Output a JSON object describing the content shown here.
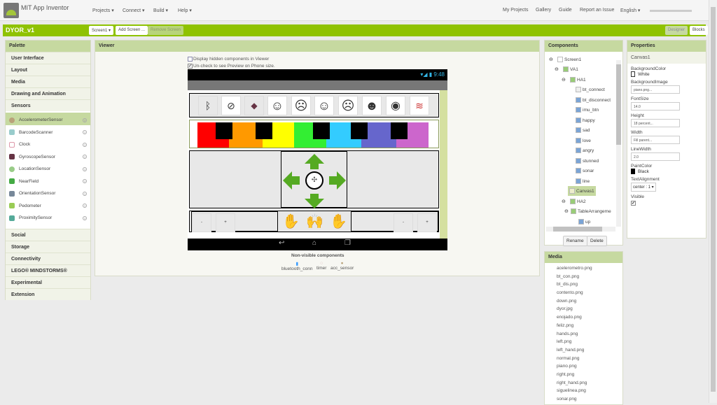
{
  "header": {
    "app_title": "MIT App Inventor",
    "menus": [
      "Projects ▾",
      "Connect ▾",
      "Build ▾",
      "Help ▾"
    ],
    "right_links": [
      "My Projects",
      "Gallery",
      "Guide",
      "Report an Issue",
      "English ▾"
    ]
  },
  "toolbar": {
    "project_name": "DYOR_v1",
    "screen_select": "Screen1 ▾",
    "add_screen": "Add Screen ...",
    "remove_screen": "Remove Screen",
    "designer": "Designer",
    "blocks": "Blocks"
  },
  "palette": {
    "title": "Palette",
    "categories_top": [
      "User Interface",
      "Layout",
      "Media",
      "Drawing and Animation",
      "Sensors"
    ],
    "sensors": [
      "AccelerometerSensor",
      "BarcodeScanner",
      "Clock",
      "GyroscopeSensor",
      "LocationSensor",
      "NearField",
      "OrientationSensor",
      "Pedometer",
      "ProximitySensor"
    ],
    "categories_bottom": [
      "Social",
      "Storage",
      "Connectivity",
      "LEGO® MINDSTORMS®",
      "Experimental",
      "Extension"
    ]
  },
  "viewer": {
    "title": "Viewer",
    "display_hidden": "Display hidden components in Viewer",
    "uncheck_preview": "Un-check to see Preview on Phone size.",
    "clock": "9:48",
    "minus": "-",
    "plus": "+",
    "nonvisible_title": "Non-visible components",
    "nonvisible": [
      "bluetooth_conn",
      "timer",
      "acc_sensor"
    ]
  },
  "components": {
    "title": "Components",
    "tree": [
      "Screen1",
      "VA1",
      "HA1",
      "bt_connect",
      "bt_disconnect",
      "imu_btn",
      "happy",
      "sad",
      "love",
      "angry",
      "stunned",
      "sonar",
      "line",
      "Canvas1",
      "HA2",
      "TableArrangeme",
      "up"
    ],
    "rename": "Rename",
    "delete": "Delete"
  },
  "properties": {
    "title": "Properties",
    "selected": "Canvas1",
    "bg_color_label": "BackgroundColor",
    "bg_color": "White",
    "bg_image_label": "BackgroundImage",
    "bg_image": "piano.png...",
    "font_size_label": "FontSize",
    "font_size": "14.0",
    "height_label": "Height",
    "height": "18 percent...",
    "width_label": "Width",
    "width": "Fill parent...",
    "line_width_label": "LineWidth",
    "line_width": "2.0",
    "paint_color_label": "PaintColor",
    "paint_color": "Black",
    "text_align_label": "TextAlignment",
    "text_align": "center : 1 ▾",
    "visible_label": "Visible"
  },
  "media": {
    "title": "Media",
    "files": [
      "acelerometro.png",
      "bt_con.png",
      "bt_dis.png",
      "contento.png",
      "down.png",
      "dyor.jpg",
      "enojado.png",
      "feliz.png",
      "hands.png",
      "left.png",
      "left_hand.png",
      "normal.png",
      "piano.png",
      "right.png",
      "right_hand.png",
      "siguelinea.png",
      "sonar.png"
    ]
  },
  "colors": {
    "brand_green": "#8fc202",
    "header_green": "#c6d9a0"
  }
}
